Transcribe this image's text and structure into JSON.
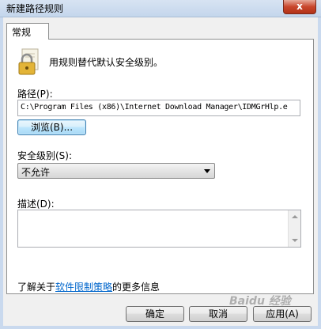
{
  "window": {
    "title": "新建路径规则",
    "close_label": "x"
  },
  "tabs": [
    {
      "label": "常规"
    }
  ],
  "intro": {
    "text": "用规则替代默认安全级别。"
  },
  "path": {
    "label": "路径(P):",
    "value": "C:\\Program Files (x86)\\Internet Download Manager\\IDMGrHlp.e",
    "browse_label": "浏览(B)..."
  },
  "security": {
    "label": "安全级别(S):",
    "selected": "不允许"
  },
  "description": {
    "label": "描述(D):",
    "value": ""
  },
  "info": {
    "prefix": "了解关于",
    "link": "软件限制策略",
    "suffix": "的更多信息"
  },
  "buttons": {
    "ok": "确定",
    "cancel": "取消",
    "apply": "应用(A)"
  },
  "watermark": "Baidu 经验"
}
